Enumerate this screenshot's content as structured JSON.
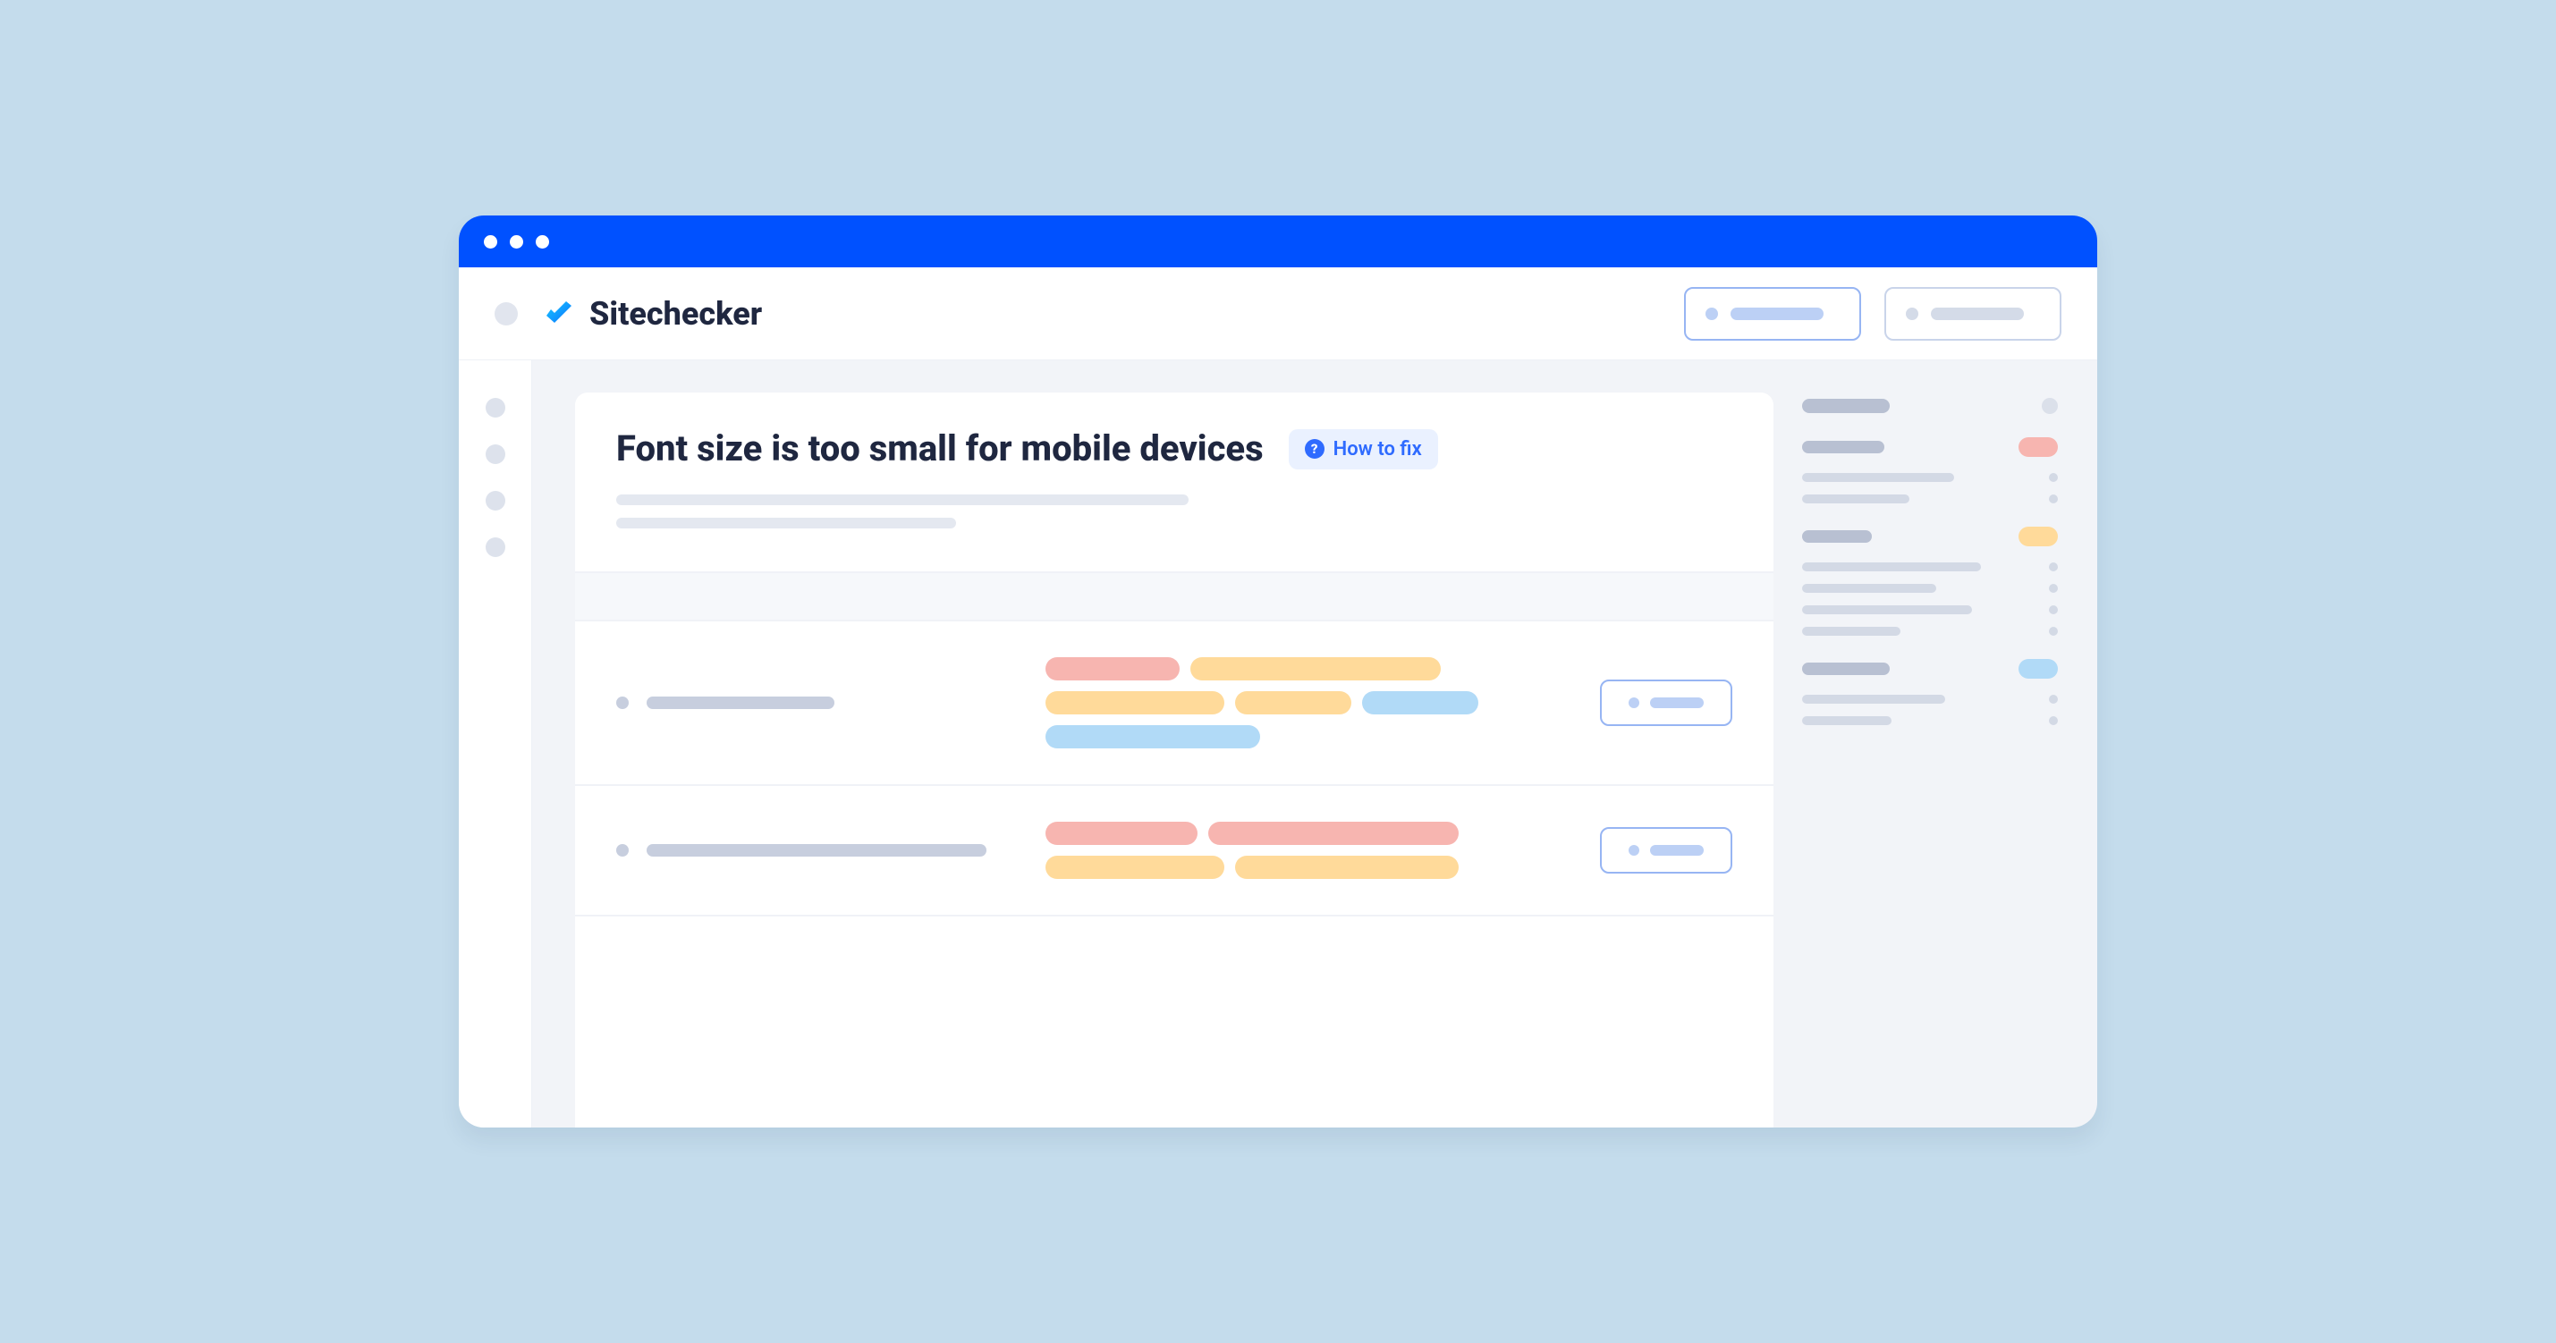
{
  "brand": {
    "name": "Sitechecker"
  },
  "issue": {
    "title": "Font size is too small for mobile devices",
    "how_to_fix_label": "How to fix"
  }
}
